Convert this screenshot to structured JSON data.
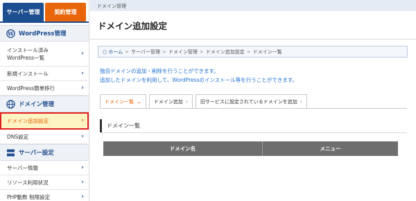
{
  "sidebar": {
    "tabs": [
      {
        "label": "サーバー管理"
      },
      {
        "label": "契約管理"
      }
    ],
    "sections": [
      {
        "title": "WordPress管理",
        "icon": "wordpress-icon",
        "items": [
          "インストール済み\nWordPress一覧",
          "新規インストール",
          "WordPress簡単移行"
        ]
      },
      {
        "title": "ドメイン管理",
        "icon": "globe-icon",
        "items": [
          "ドメイン追加設定",
          "DNS設定"
        ]
      },
      {
        "title": "サーバー設定",
        "icon": "server-icon",
        "items": [
          "サーバー情報",
          "リソース利用状況",
          "PHP動数 制限設定"
        ]
      }
    ]
  },
  "header": {
    "top_breadcrumb": "ドメイン管理",
    "title": "ドメイン追加設定"
  },
  "breadcrumbs": [
    "ホーム",
    "サーバー管理",
    "ドメイン管理",
    "ドメイン追加設定",
    "ドメイン一覧"
  ],
  "description": [
    "独自ドメインの追加・削除を行うことができます。",
    "追加したドメインを利用して、WordPressのインストール等を行うことができます。"
  ],
  "page_tabs": [
    "ドメイン一覧",
    "ドメイン追加",
    "旧サービスに設定されているドメインを追加"
  ],
  "list_title": "ドメイン一覧",
  "table": {
    "columns": [
      "ドメイン名",
      "メニュー"
    ]
  },
  "colors": {
    "brand_blue": "#1d4e8f",
    "accent_orange": "#e8650a",
    "highlight_red": "#e02020",
    "link_blue": "#1d6fd0"
  }
}
